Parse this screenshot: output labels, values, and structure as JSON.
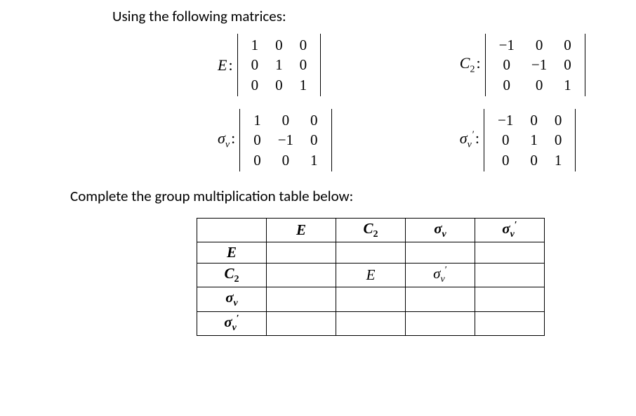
{
  "text": {
    "intro": "Using the following matrices:",
    "instruction": "Complete the group multiplication table below:"
  },
  "matrices": {
    "E": {
      "label_html": "<span class=\"mi\">E</span><span class=\"colon\">:</span>",
      "rows": [
        [
          "1",
          "0",
          "0"
        ],
        [
          "0",
          "1",
          "0"
        ],
        [
          "0",
          "0",
          "1"
        ]
      ]
    },
    "C2": {
      "label_html": "<span class=\"mi\">C</span><span class=\"sub\">2</span><span class=\"colon\">:</span>",
      "rows": [
        [
          "−1",
          "0",
          "0"
        ],
        [
          "0",
          "−1",
          "0"
        ],
        [
          "0",
          "0",
          "1"
        ]
      ]
    },
    "sigma_v": {
      "label_html": "<span class=\"mi\">σ</span><span class=\"subi\">v</span><span class=\"colon\">:</span>",
      "rows": [
        [
          "1",
          "0",
          "0"
        ],
        [
          "0",
          "−1",
          "0"
        ],
        [
          "0",
          "0",
          "1"
        ]
      ]
    },
    "sigma_v_prime": {
      "label_html": "<span class=\"mi\">σ</span><span class=\"subi\">v</span><span class=\"sup\">′</span><span class=\"colon\">:</span>",
      "rows": [
        [
          "−1",
          "0",
          "0"
        ],
        [
          "0",
          "1",
          "0"
        ],
        [
          "0",
          "0",
          "1"
        ]
      ]
    }
  },
  "table": {
    "col_headers_html": [
      "<span class=\"hdr\"><span class=\"mi\">E</span></span>",
      "<span class=\"hdr\"><span class=\"mi\">C</span><span class=\"sub\">2</span></span>",
      "<span class=\"hdr\"><span class=\"mi\">σ</span><span class=\"subi\">v</span></span>",
      "<span class=\"hdr\"><span class=\"mi\">σ</span><span class=\"subi\">v</span><span class=\"sup\">′</span></span>"
    ],
    "row_headers_html": [
      "<span class=\"hdr\"><span class=\"mi\">E</span></span>",
      "<span class=\"hdr\"><span class=\"mi\">C</span><span class=\"sub\">2</span></span>",
      "<span class=\"hdr\"><span class=\"mi\">σ</span><span class=\"subi\">v</span></span>",
      "<span class=\"hdr\"><span class=\"mi\">σ</span><span class=\"subi\">v</span><span class=\"sup\">′</span></span>"
    ],
    "cells_html": [
      [
        "",
        "",
        "",
        ""
      ],
      [
        "",
        "<span class=\"mi\">E</span>",
        "<span class=\"mi\">σ</span><span class=\"subi\">v</span><span class=\"sup\">′</span>",
        ""
      ],
      [
        "",
        "",
        "",
        ""
      ],
      [
        "",
        "",
        "",
        ""
      ]
    ]
  }
}
